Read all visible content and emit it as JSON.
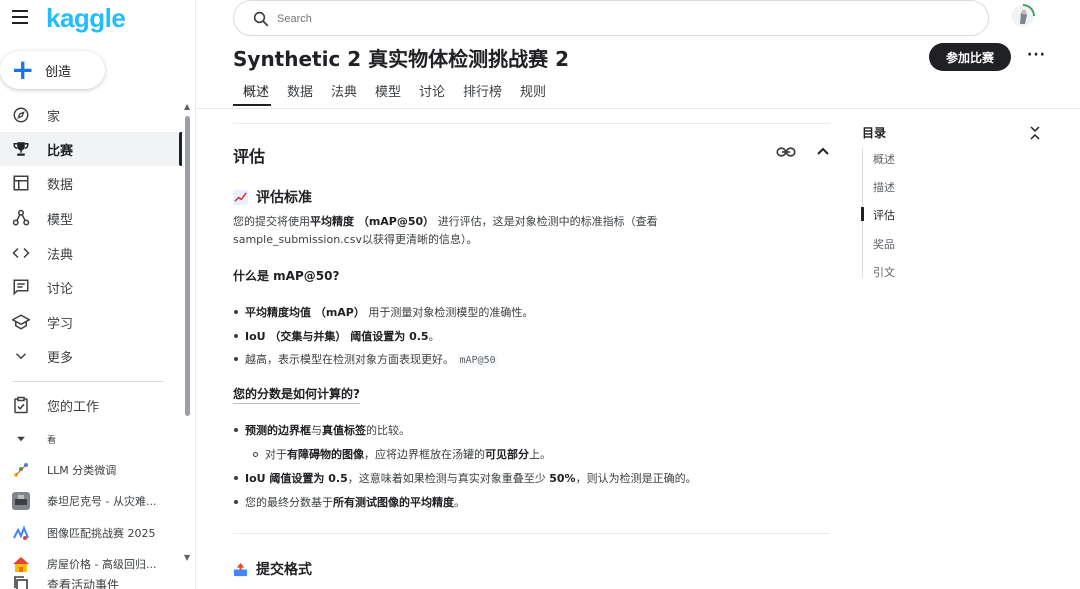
{
  "app": {
    "logo": "kaggle",
    "create_label": "创造"
  },
  "sidebar": {
    "items": [
      {
        "label": "家",
        "icon": "compass-icon"
      },
      {
        "label": "比赛",
        "icon": "trophy-icon",
        "active": true
      },
      {
        "label": "数据",
        "icon": "table-icon"
      },
      {
        "label": "模型",
        "icon": "models-icon"
      },
      {
        "label": "法典",
        "icon": "code-icon"
      },
      {
        "label": "讨论",
        "icon": "comment-icon"
      },
      {
        "label": "学习",
        "icon": "school-icon"
      },
      {
        "label": "更多",
        "icon": "chevron-down-icon"
      }
    ],
    "your_work": "您的工作",
    "recent_header": "看",
    "recent": [
      {
        "label": "LLM 分类微调",
        "color": "#e8eaed"
      },
      {
        "label": "泰坦尼克号 - 从灾难...",
        "color": "#5f6368"
      },
      {
        "label": "图像匹配挑战赛 2025",
        "color": "#4285f4"
      },
      {
        "label": "房屋价格 - 高级回归...",
        "color": "#ea4335"
      }
    ],
    "view_activity": "查看活动事件"
  },
  "search": {
    "placeholder": "Search"
  },
  "header": {
    "title": "Synthetic 2 真实物体检测挑战赛 2",
    "join_label": "参加比赛",
    "more_label": "···"
  },
  "tabs": [
    "概述",
    "数据",
    "法典",
    "模型",
    "讨论",
    "排行榜",
    "规则"
  ],
  "content": {
    "section_title": "评估",
    "criteria_heading": "评估标准",
    "intro_pre": "您的提交将使用",
    "intro_bold": "平均精度 （mAP@50）",
    "intro_post": "进行评估，这是对象检测中的标准指标（查看",
    "intro_line2": "sample_submission.csv以获得更清晰的信息）。",
    "what_is_heading": "什么是 mAP@50?",
    "b1_bold": "平均精度均值 （mAP）",
    "b1_text": "用于测量对象检测模型的准确性。",
    "b2_bold": "IoU （交集与并集） 阈值设置为 0.5",
    "b2_text": "。",
    "b3_text": "越高，表示模型在检测对象方面表现更好。",
    "b3_code": "mAP@50",
    "how_heading": "您的分数是如何计算的?",
    "c1_bold1": "预测的边界框",
    "c1_mid": "与",
    "c1_bold2": "真值标签",
    "c1_text": "的比较。",
    "c1a_pre": "对于",
    "c1a_bold1": "有障碍物的图像",
    "c1a_mid": "，应将边界框放在汤罐的",
    "c1a_bold2": "可见部分",
    "c1a_post": "上。",
    "c2_bold1": "IoU 阈值设置为 0.5",
    "c2_mid": "，这意味着如果检测与真实对象重叠至少",
    "c2_bold2": "50%",
    "c2_post": "，则认为检测是正确的。",
    "c3_pre": "您的最终分数基于",
    "c3_bold": "所有测试图像的平均精度",
    "c3_post": "。",
    "submission_heading": "提交格式"
  },
  "toc": {
    "title": "目录",
    "items": [
      "概述",
      "描述",
      "评估",
      "奖品",
      "引文"
    ],
    "active_index": 2
  },
  "colors": {
    "brand": "#20beff",
    "accent": "#1a73e8",
    "dark": "#202124"
  }
}
